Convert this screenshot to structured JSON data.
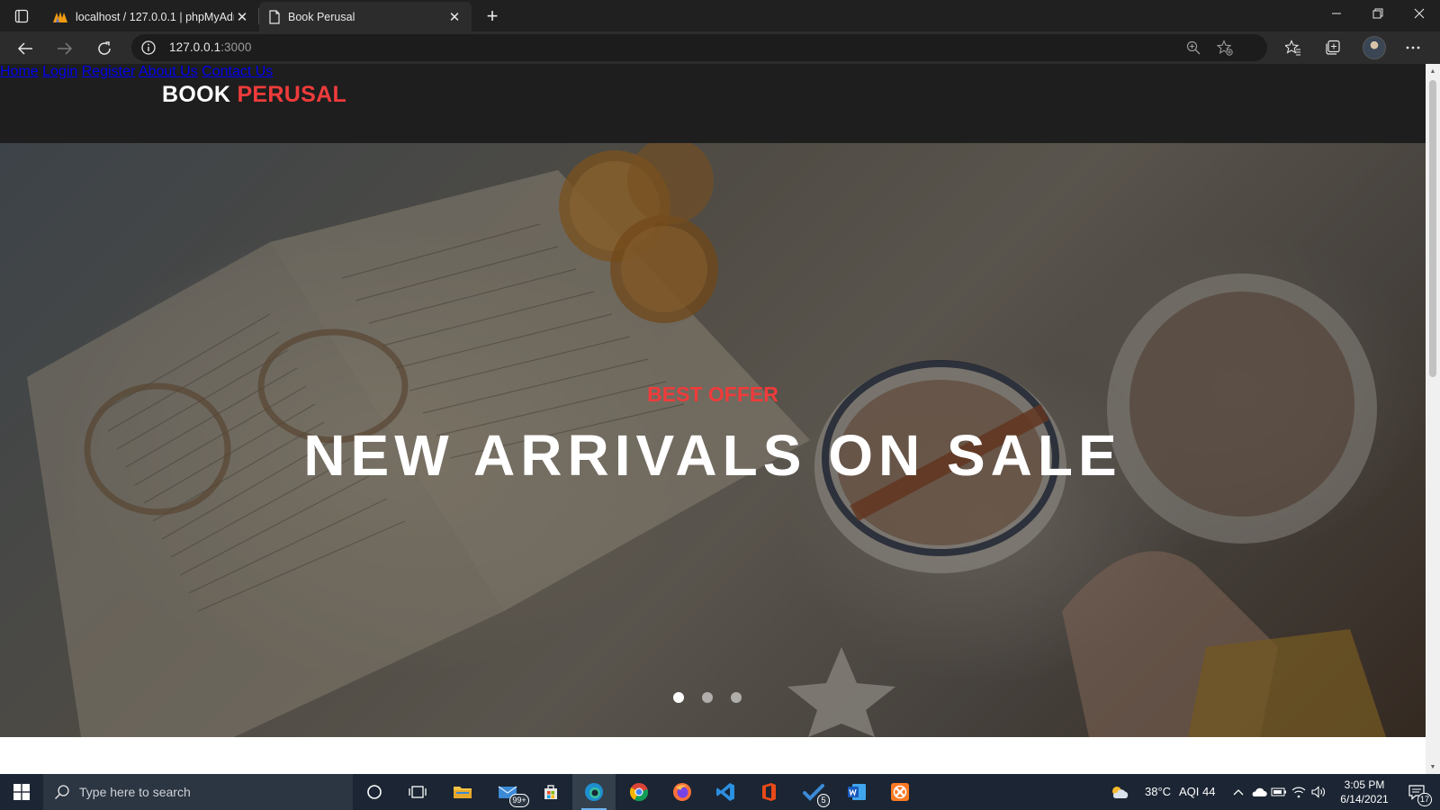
{
  "browser": {
    "tabs": [
      {
        "title": "localhost / 127.0.0.1 | phpMyAdmin",
        "active": false,
        "icon": "phpmyadmin-icon"
      },
      {
        "title": "Book Perusal",
        "active": true,
        "icon": "page-icon"
      }
    ],
    "address": {
      "host": "127.0.0.1",
      "port": ":3000"
    }
  },
  "site": {
    "brand": {
      "part1": "BOOK ",
      "part2": "PERUSAL",
      "accent_color": "#ef3b3b"
    },
    "nav": [
      "Home",
      "Login",
      "Register",
      "About Us",
      "Contact Us"
    ],
    "hero": {
      "eyebrow": "BEST OFFER",
      "headline": "NEW ARRIVALS ON SALE",
      "slide_count": 3,
      "active_slide": 1
    }
  },
  "taskbar": {
    "search_placeholder": "Type here to search",
    "mail_badge": "99+",
    "todo_badge": "5",
    "weather": "38°C",
    "aqi": "AQI 44",
    "time": "3:05 PM",
    "date": "6/14/2021",
    "notification_count": "17"
  }
}
